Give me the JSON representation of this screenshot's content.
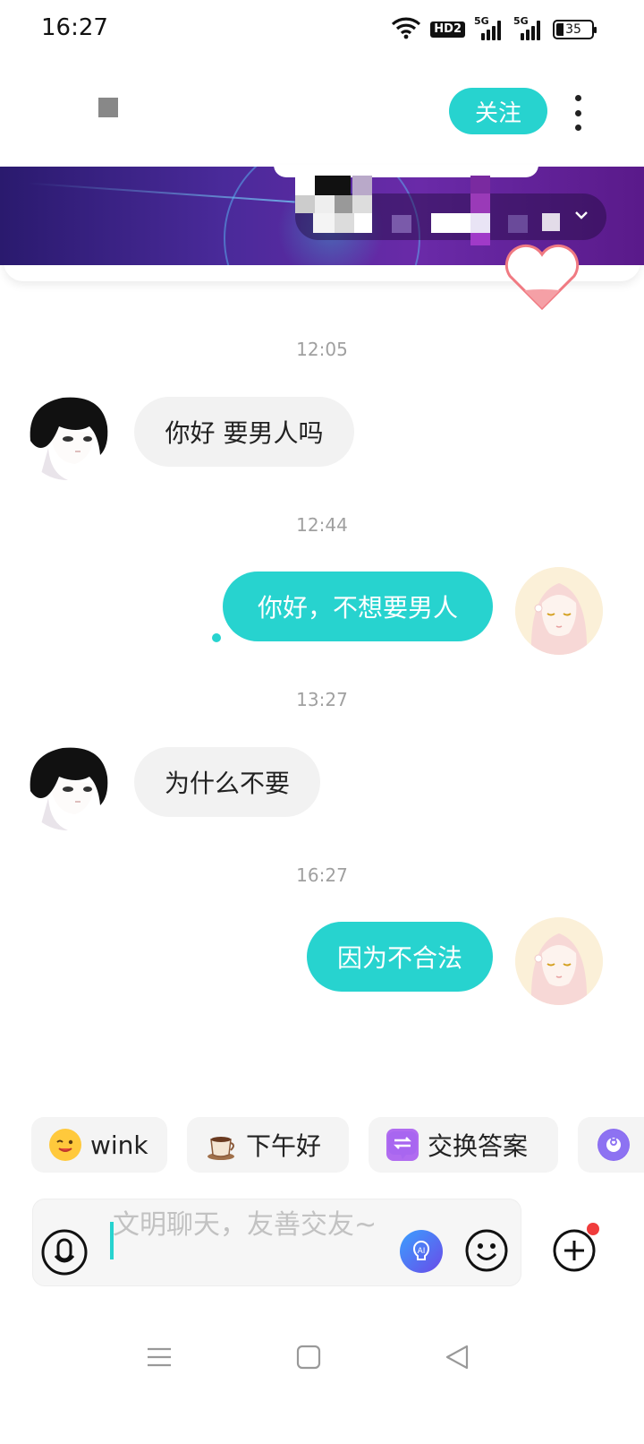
{
  "status_bar": {
    "time": "16:27",
    "hd_label": "HD2",
    "signal_1_label": "5G",
    "signal_2_label": "5G",
    "battery": "35"
  },
  "header": {
    "follow_label": "关注",
    "sub_text": "",
    "more_icon": "more-vertical-icon"
  },
  "banner": {
    "chevron_icon": "chevron-down-icon"
  },
  "messages": [
    {
      "time": "12:05",
      "direction": "in",
      "text": "你好 要男人吗"
    },
    {
      "time": "12:44",
      "direction": "out",
      "text": "你好，不想要男人"
    },
    {
      "time": "13:27",
      "direction": "in",
      "text": "为什么不要"
    },
    {
      "time": "16:27",
      "direction": "out",
      "text": "因为不合法"
    }
  ],
  "quick_replies": [
    {
      "label": "wink",
      "icon": "wink-emoji-icon"
    },
    {
      "label": "下午好",
      "icon": "coffee-icon"
    },
    {
      "label": "交换答案",
      "icon": "exchange-icon"
    },
    {
      "label": "",
      "icon": "eight-ball-icon"
    }
  ],
  "input": {
    "placeholder": "文明聊天，友善交友~"
  },
  "colors": {
    "accent": "#27d3cf",
    "incoming_bubble": "#f2f2f2",
    "notification_dot": "#f03c3c"
  }
}
